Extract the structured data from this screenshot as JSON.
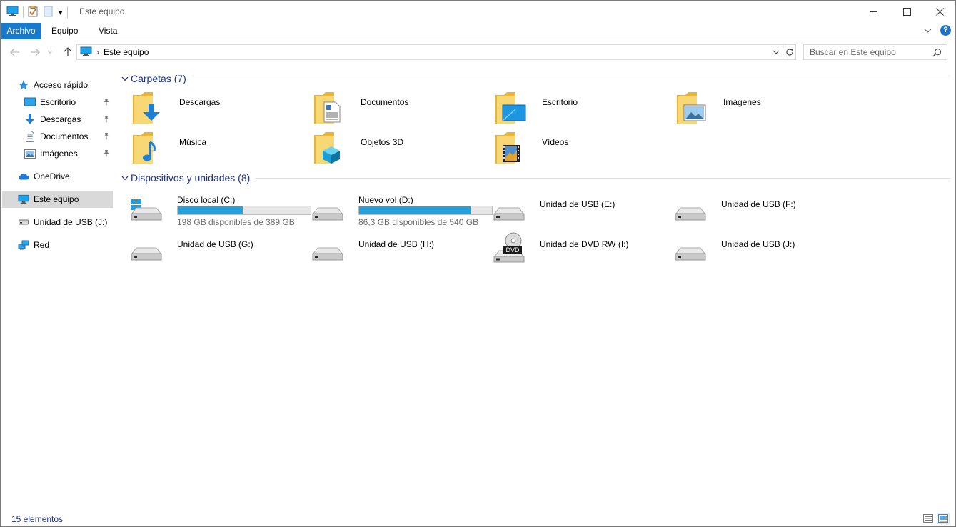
{
  "window": {
    "title": "Este equipo",
    "qat_dropdown": "▾"
  },
  "ribbon": {
    "tabs": [
      {
        "label": "Archivo"
      },
      {
        "label": "Equipo"
      },
      {
        "label": "Vista"
      }
    ],
    "help_label": "?"
  },
  "address": {
    "crumb_separator": "›",
    "location": "Este equipo",
    "search_placeholder": "Buscar en Este equipo"
  },
  "sidebar": {
    "items": [
      {
        "label": "Acceso rápido",
        "icon": "star-icon"
      },
      {
        "label": "Escritorio",
        "icon": "desktop-icon",
        "pinned": true
      },
      {
        "label": "Descargas",
        "icon": "download-icon",
        "pinned": true
      },
      {
        "label": "Documentos",
        "icon": "documents-icon",
        "pinned": true
      },
      {
        "label": "Imágenes",
        "icon": "pictures-icon",
        "pinned": true
      },
      {
        "label": "OneDrive",
        "icon": "cloud-icon"
      },
      {
        "label": "Este equipo",
        "icon": "computer-icon",
        "selected": true
      },
      {
        "label": "Unidad de USB (J:)",
        "icon": "usb-drive-icon"
      },
      {
        "label": "Red",
        "icon": "network-icon"
      }
    ]
  },
  "folders": {
    "title": "Carpetas (7)",
    "items": [
      {
        "label": "Descargas",
        "icon": "downloads-folder-icon"
      },
      {
        "label": "Documentos",
        "icon": "documents-folder-icon"
      },
      {
        "label": "Escritorio",
        "icon": "desktop-folder-icon"
      },
      {
        "label": "Imágenes",
        "icon": "pictures-folder-icon"
      },
      {
        "label": "Música",
        "icon": "music-folder-icon"
      },
      {
        "label": "Objetos 3D",
        "icon": "3d-objects-folder-icon"
      },
      {
        "label": "Vídeos",
        "icon": "videos-folder-icon"
      }
    ]
  },
  "devices": {
    "title": "Dispositivos y unidades (8)",
    "items": [
      {
        "label": "Disco local (C:)",
        "free": "198 GB disponibles de 389 GB",
        "used_fraction": 0.49,
        "icon": "windows-drive-icon"
      },
      {
        "label": "Nuevo vol (D:)",
        "free": "86,3 GB disponibles de 540 GB",
        "used_fraction": 0.84,
        "icon": "hard-drive-icon"
      },
      {
        "label": "Unidad de USB (E:)",
        "icon": "usb-drive-icon"
      },
      {
        "label": "Unidad de USB (F:)",
        "icon": "usb-drive-icon"
      },
      {
        "label": "Unidad de USB (G:)",
        "icon": "usb-drive-icon"
      },
      {
        "label": "Unidad de USB (H:)",
        "icon": "usb-drive-icon"
      },
      {
        "label": "Unidad de DVD RW (I:)",
        "icon": "dvd-drive-icon",
        "badge": "DVD"
      },
      {
        "label": "Unidad de USB (J:)",
        "icon": "usb-drive-icon"
      }
    ]
  },
  "status": {
    "count": "15 elementos"
  },
  "colors": {
    "accent": "#1979ca",
    "group_title": "#1e3287",
    "bar_fill": "#26a0da",
    "folder_yellow": "#f8d775",
    "selected_bg": "#d9d9d9"
  }
}
